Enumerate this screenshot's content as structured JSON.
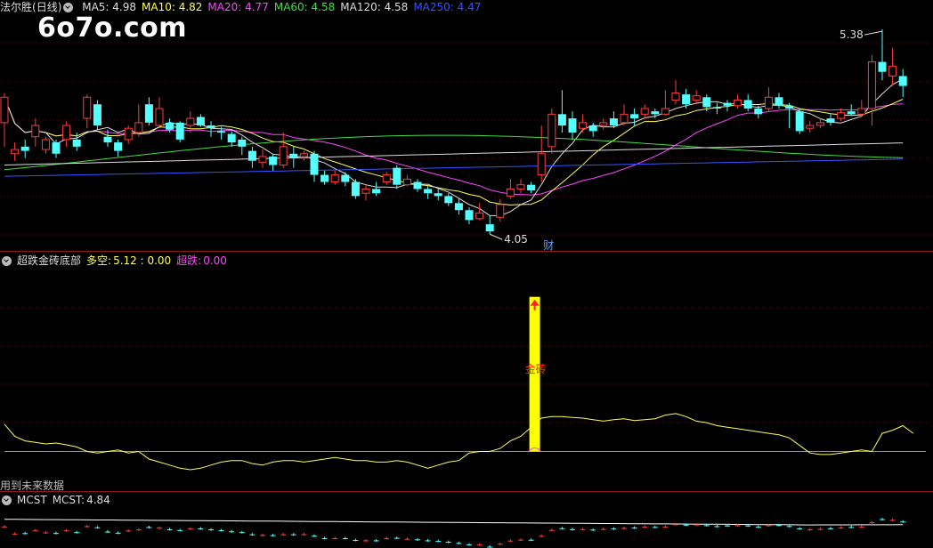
{
  "watermark": "6o7o.com",
  "main_panel": {
    "stock_name": "法尔胜",
    "period": "(日线)",
    "ma": [
      {
        "label": "MA5:",
        "value": "4.98",
        "color": "#dddddd"
      },
      {
        "label": "MA10:",
        "value": "4.82",
        "color": "#ffff55"
      },
      {
        "label": "MA20:",
        "value": "4.77",
        "color": "#ff44ff"
      },
      {
        "label": "MA60:",
        "value": "4.58",
        "color": "#44dd44"
      },
      {
        "label": "MA120:",
        "value": "4.58",
        "color": "#dddddd"
      },
      {
        "label": "MA250:",
        "value": "4.47",
        "color": "#3355ff"
      }
    ],
    "high_label": "5.38",
    "low_label": "4.05",
    "finance_marker": "财"
  },
  "indicator_panel": {
    "name": "超跌金砖底部",
    "duokong_label": "多空:",
    "duokong_value": "5.12 : 0.00",
    "chaodie_label": "超跌:",
    "chaodie_value": "0.00",
    "signal_text": "金砖",
    "future_note": "用到未来数据"
  },
  "mcst_panel": {
    "name": "MCST",
    "label": "MCST:",
    "value": "4.84"
  },
  "chart_data": {
    "type": "candlestick",
    "price_axis": {
      "min": 3.9,
      "max": 5.45
    },
    "candles": [
      [
        4.72,
        4.9,
        4.93,
        4.55
      ],
      [
        4.5,
        4.53,
        4.58,
        4.45
      ],
      [
        4.55,
        4.52,
        4.6,
        4.47
      ],
      [
        4.62,
        4.7,
        4.75,
        4.55
      ],
      [
        4.53,
        4.6,
        4.62,
        4.5
      ],
      [
        4.58,
        4.5,
        4.6,
        4.47
      ],
      [
        4.6,
        4.7,
        4.73,
        4.55
      ],
      [
        4.6,
        4.55,
        4.65,
        4.52
      ],
      [
        4.75,
        4.9,
        4.92,
        4.68
      ],
      [
        4.85,
        4.7,
        4.88,
        4.67
      ],
      [
        4.62,
        4.58,
        4.67,
        4.55
      ],
      [
        4.58,
        4.52,
        4.6,
        4.48
      ],
      [
        4.6,
        4.68,
        4.7,
        4.57
      ],
      [
        4.65,
        4.72,
        4.85,
        4.62
      ],
      [
        4.85,
        4.72,
        4.9,
        4.7
      ],
      [
        4.7,
        4.82,
        4.9,
        4.68
      ],
      [
        4.72,
        4.67,
        4.75,
        4.65
      ],
      [
        4.72,
        4.6,
        4.73,
        4.58
      ],
      [
        4.7,
        4.75,
        4.8,
        4.65
      ],
      [
        4.76,
        4.7,
        4.78,
        4.69
      ],
      [
        4.7,
        4.68,
        4.73,
        4.62
      ],
      [
        4.66,
        4.65,
        4.69,
        4.6
      ],
      [
        4.64,
        4.58,
        4.66,
        4.55
      ],
      [
        4.6,
        4.55,
        4.62,
        4.49
      ],
      [
        4.52,
        4.45,
        4.55,
        4.4
      ],
      [
        4.44,
        4.48,
        4.53,
        4.4
      ],
      [
        4.48,
        4.42,
        4.5,
        4.38
      ],
      [
        4.42,
        4.55,
        4.65,
        4.4
      ],
      [
        4.5,
        4.47,
        4.55,
        4.4
      ],
      [
        4.48,
        4.5,
        4.52,
        4.45
      ],
      [
        4.5,
        4.35,
        4.52,
        4.3
      ],
      [
        4.35,
        4.3,
        4.38,
        4.28
      ],
      [
        4.3,
        4.35,
        4.38,
        4.28
      ],
      [
        4.35,
        4.3,
        4.37,
        4.27
      ],
      [
        4.3,
        4.2,
        4.32,
        4.18
      ],
      [
        4.22,
        4.25,
        4.28,
        4.17
      ],
      [
        4.25,
        4.22,
        4.3,
        4.2
      ],
      [
        4.3,
        4.35,
        4.37,
        4.28
      ],
      [
        4.4,
        4.28,
        4.42,
        4.25
      ],
      [
        4.28,
        4.32,
        4.35,
        4.27
      ],
      [
        4.3,
        4.25,
        4.32,
        4.23
      ],
      [
        4.25,
        4.22,
        4.27,
        4.18
      ],
      [
        4.22,
        4.2,
        4.25,
        4.17
      ],
      [
        4.2,
        4.15,
        4.22,
        4.13
      ],
      [
        4.15,
        4.1,
        4.18,
        4.07
      ],
      [
        4.1,
        4.03,
        4.12,
        4.0
      ],
      [
        4.04,
        4.08,
        4.15,
        4.03
      ],
      [
        4.0,
        3.95,
        4.06,
        3.93
      ],
      [
        4.05,
        4.14,
        4.18,
        4.02
      ],
      [
        4.2,
        4.25,
        4.32,
        4.18
      ],
      [
        4.25,
        4.28,
        4.32,
        4.22
      ],
      [
        4.28,
        4.24,
        4.3,
        4.22
      ],
      [
        4.35,
        4.5,
        4.7,
        4.3
      ],
      [
        4.55,
        4.78,
        4.82,
        4.5
      ],
      [
        4.78,
        4.7,
        4.95,
        4.65
      ],
      [
        4.75,
        4.65,
        4.8,
        4.6
      ],
      [
        4.68,
        4.72,
        4.78,
        4.65
      ],
      [
        4.7,
        4.66,
        4.72,
        4.62
      ],
      [
        4.7,
        4.72,
        4.75,
        4.67
      ],
      [
        4.75,
        4.7,
        4.8,
        4.68
      ],
      [
        4.72,
        4.78,
        4.85,
        4.7
      ],
      [
        4.78,
        4.75,
        4.82,
        4.7
      ],
      [
        4.78,
        4.82,
        4.85,
        4.75
      ],
      [
        4.8,
        4.78,
        4.82,
        4.75
      ],
      [
        4.78,
        4.82,
        4.95,
        4.77
      ],
      [
        4.88,
        4.93,
        5.02,
        4.85
      ],
      [
        4.92,
        4.85,
        4.96,
        4.82
      ],
      [
        4.88,
        4.91,
        4.95,
        4.85
      ],
      [
        4.9,
        4.83,
        4.92,
        4.8
      ],
      [
        4.83,
        4.82,
        4.86,
        4.78
      ],
      [
        4.86,
        4.84,
        4.88,
        4.8
      ],
      [
        4.84,
        4.88,
        4.92,
        4.82
      ],
      [
        4.88,
        4.82,
        4.92,
        4.8
      ],
      [
        4.82,
        4.78,
        4.84,
        4.75
      ],
      [
        4.82,
        4.9,
        4.97,
        4.8
      ],
      [
        4.9,
        4.84,
        4.93,
        4.82
      ],
      [
        4.84,
        4.82,
        4.86,
        4.68
      ],
      [
        4.8,
        4.66,
        4.82,
        4.64
      ],
      [
        4.68,
        4.7,
        4.73,
        4.65
      ],
      [
        4.7,
        4.72,
        4.75,
        4.68
      ],
      [
        4.75,
        4.72,
        4.78,
        4.7
      ],
      [
        4.75,
        4.79,
        4.82,
        4.73
      ],
      [
        4.8,
        4.78,
        4.85,
        4.77
      ],
      [
        4.78,
        4.82,
        4.88,
        4.76
      ],
      [
        4.82,
        5.15,
        5.2,
        4.7
      ],
      [
        5.15,
        5.08,
        5.38,
        5.02
      ],
      [
        5.05,
        5.12,
        5.25,
        4.98
      ],
      [
        5.05,
        4.98,
        5.1,
        4.9
      ]
    ],
    "ma_series_close_based": [
      "MA5",
      "MA10",
      "MA20",
      "MA60",
      "MA120",
      "MA250"
    ],
    "indicator": {
      "zero_line": 0.0,
      "signal_bar_index": 51,
      "duokong_line": [
        0.9,
        0.5,
        0.35,
        0.3,
        0.25,
        0.28,
        0.22,
        0.15,
        0.0,
        -0.05,
        0.0,
        0.05,
        -0.05,
        0.0,
        -0.25,
        -0.35,
        -0.45,
        -0.55,
        -0.6,
        -0.55,
        -0.45,
        -0.35,
        -0.3,
        -0.3,
        -0.4,
        -0.45,
        -0.35,
        -0.3,
        -0.3,
        -0.35,
        -0.3,
        -0.25,
        -0.2,
        -0.25,
        -0.3,
        -0.3,
        -0.35,
        -0.35,
        -0.3,
        -0.35,
        -0.45,
        -0.55,
        -0.45,
        -0.35,
        -0.3,
        -0.05,
        0.0,
        0.0,
        0.1,
        0.35,
        0.5,
        0.8,
        1.1,
        1.15,
        1.15,
        1.12,
        1.1,
        1.05,
        1.0,
        1.05,
        1.08,
        1.02,
        1.05,
        1.08,
        1.2,
        1.25,
        1.15,
        1.0,
        0.95,
        0.85,
        0.8,
        0.75,
        0.7,
        0.65,
        0.6,
        0.55,
        0.45,
        0.2,
        -0.05,
        -0.1,
        -0.1,
        -0.05,
        0.0,
        0.05,
        0.0,
        0.6,
        0.7,
        0.85,
        0.6
      ],
      "y_range": [
        -1.1,
        6.0
      ]
    }
  }
}
